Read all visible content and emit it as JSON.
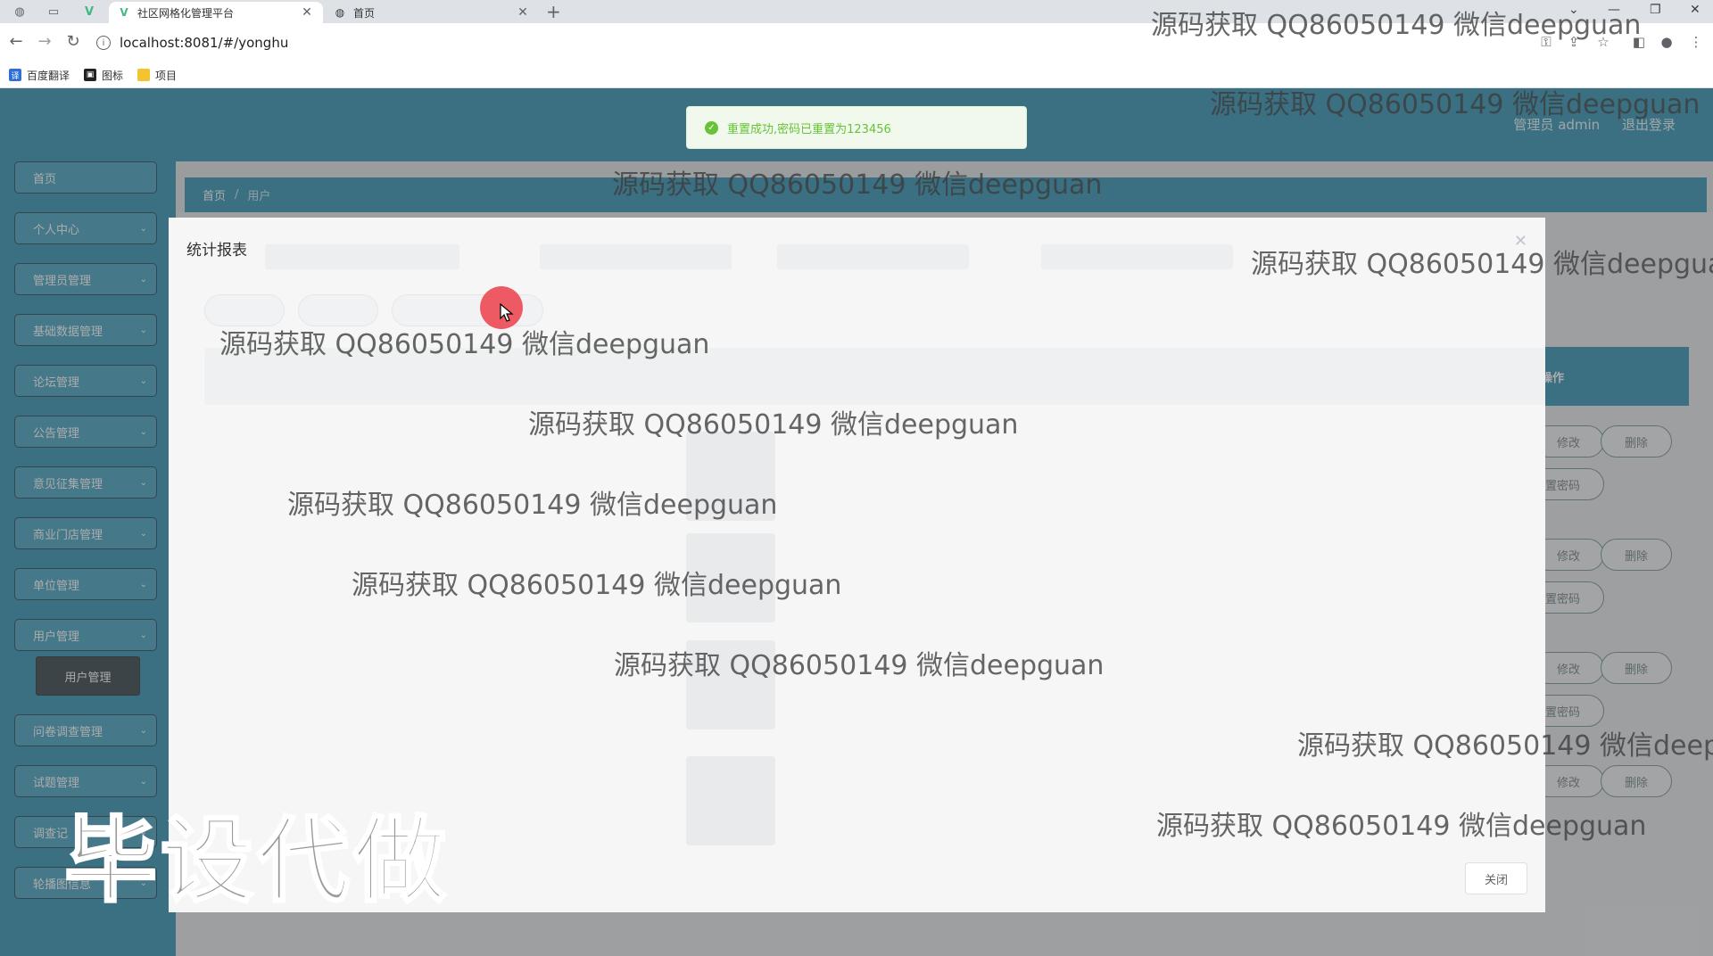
{
  "browser": {
    "tabs": [
      {
        "title": "社区网格化管理平台",
        "active": true,
        "icon": "vue-logo-icon"
      },
      {
        "title": "首页",
        "active": false,
        "icon": "globe-icon"
      }
    ],
    "url": "localhost:8081/#/yonghu",
    "bookmarks": [
      {
        "label": "百度翻译",
        "icon": "translate-icon"
      },
      {
        "label": "图标",
        "icon": "image-icon"
      },
      {
        "label": "项目",
        "icon": "folder-icon"
      }
    ]
  },
  "header": {
    "role_label": "管理员 admin",
    "logout_label": "退出登录"
  },
  "toast": {
    "message": "重置成功,密码已重置为123456",
    "icon": "check-circle-icon"
  },
  "sidebar": {
    "items": [
      {
        "label": "首页",
        "has_chevron": false
      },
      {
        "label": "个人中心",
        "has_chevron": true
      },
      {
        "label": "管理员管理",
        "has_chevron": true
      },
      {
        "label": "基础数据管理",
        "has_chevron": true
      },
      {
        "label": "论坛管理",
        "has_chevron": true
      },
      {
        "label": "公告管理",
        "has_chevron": true
      },
      {
        "label": "意见征集管理",
        "has_chevron": true
      },
      {
        "label": "商业门店管理",
        "has_chevron": true
      },
      {
        "label": "单位管理",
        "has_chevron": true
      },
      {
        "label": "用户管理",
        "has_chevron": true
      },
      {
        "label": "问卷调查管理",
        "has_chevron": true
      },
      {
        "label": "试题管理",
        "has_chevron": true
      },
      {
        "label": "调查记",
        "has_chevron": true
      },
      {
        "label": "轮播图信息",
        "has_chevron": true
      }
    ],
    "active_sub": "用户管理"
  },
  "breadcrumb": {
    "home": "首页",
    "current": "用户"
  },
  "table": {
    "operation_header": "操作",
    "row_buttons": {
      "edit": "修改",
      "delete": "删除",
      "reset": "重置密码"
    }
  },
  "dialog": {
    "title": "统计报表",
    "close_button": "关闭"
  },
  "overlay": {
    "watermark_text": "源码获取 QQ86050149 微信deepguan",
    "big_text": "毕设代做"
  },
  "colors": {
    "primary": "#2a8fb0",
    "sidebar_border": "#1f3f52",
    "toast_green": "#67c23a",
    "cursor_red": "#ee5a63"
  }
}
